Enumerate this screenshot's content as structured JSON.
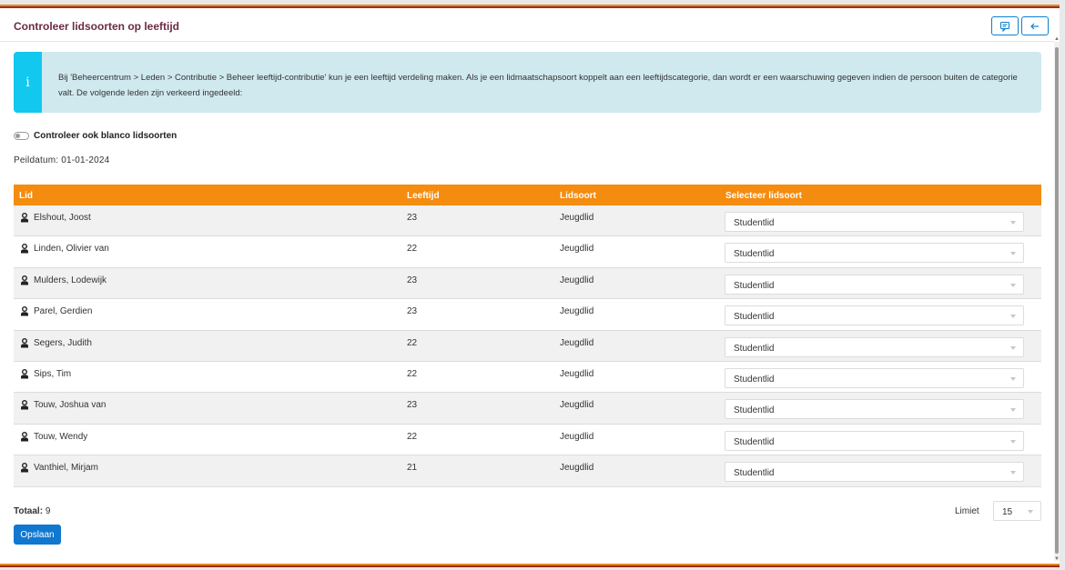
{
  "header": {
    "title": "Controleer lidsoorten op leeftijd",
    "buttons": [
      {
        "icon": "comment-icon"
      },
      {
        "icon": "arrow-left-icon"
      }
    ]
  },
  "info": {
    "icon": "info-icon",
    "glyph": "i",
    "text": "Bij 'Beheercentrum > Leden > Contributie > Beheer leeftijd-contributie' kun je een leeftijd verdeling maken. Als je een lidmaatschapsoort koppelt aan een leeftijdscategorie, dan wordt er een waarschuwing gegeven indien de persoon buiten de categorie valt. De volgende leden zijn verkeerd ingedeeld:"
  },
  "toggle": {
    "label": "Controleer ook blanco lidsoorten",
    "checked": false
  },
  "peildatum": "Peildatum: 01-01-2024",
  "table": {
    "columns": [
      "Lid",
      "Leeftijd",
      "Lidsoort",
      "Selecteer lidsoort"
    ],
    "rows": [
      {
        "name": "Elshout, Joost",
        "age": "23",
        "type": "Jeugdlid",
        "select": "Studentlid"
      },
      {
        "name": "Linden, Olivier van",
        "age": "22",
        "type": "Jeugdlid",
        "select": "Studentlid"
      },
      {
        "name": "Mulders, Lodewijk",
        "age": "23",
        "type": "Jeugdlid",
        "select": "Studentlid"
      },
      {
        "name": "Parel, Gerdien",
        "age": "23",
        "type": "Jeugdlid",
        "select": "Studentlid"
      },
      {
        "name": "Segers, Judith",
        "age": "22",
        "type": "Jeugdlid",
        "select": "Studentlid"
      },
      {
        "name": "Sips, Tim",
        "age": "22",
        "type": "Jeugdlid",
        "select": "Studentlid"
      },
      {
        "name": "Touw, Joshua van",
        "age": "23",
        "type": "Jeugdlid",
        "select": "Studentlid"
      },
      {
        "name": "Touw, Wendy",
        "age": "22",
        "type": "Jeugdlid",
        "select": "Studentlid"
      },
      {
        "name": "Vanthiel, Mirjam",
        "age": "21",
        "type": "Jeugdlid",
        "select": "Studentlid"
      }
    ]
  },
  "footer": {
    "total_label": "Totaal:",
    "total_value": "9",
    "limit_label": "Limiet",
    "limit_value": "15",
    "save_label": "Opslaan"
  },
  "colors": {
    "title": "#6b2a44",
    "table_header": "#f48c10",
    "info_bg": "#cfe9ef",
    "info_accent": "#13c8ee",
    "primary_button": "#1078cf"
  }
}
